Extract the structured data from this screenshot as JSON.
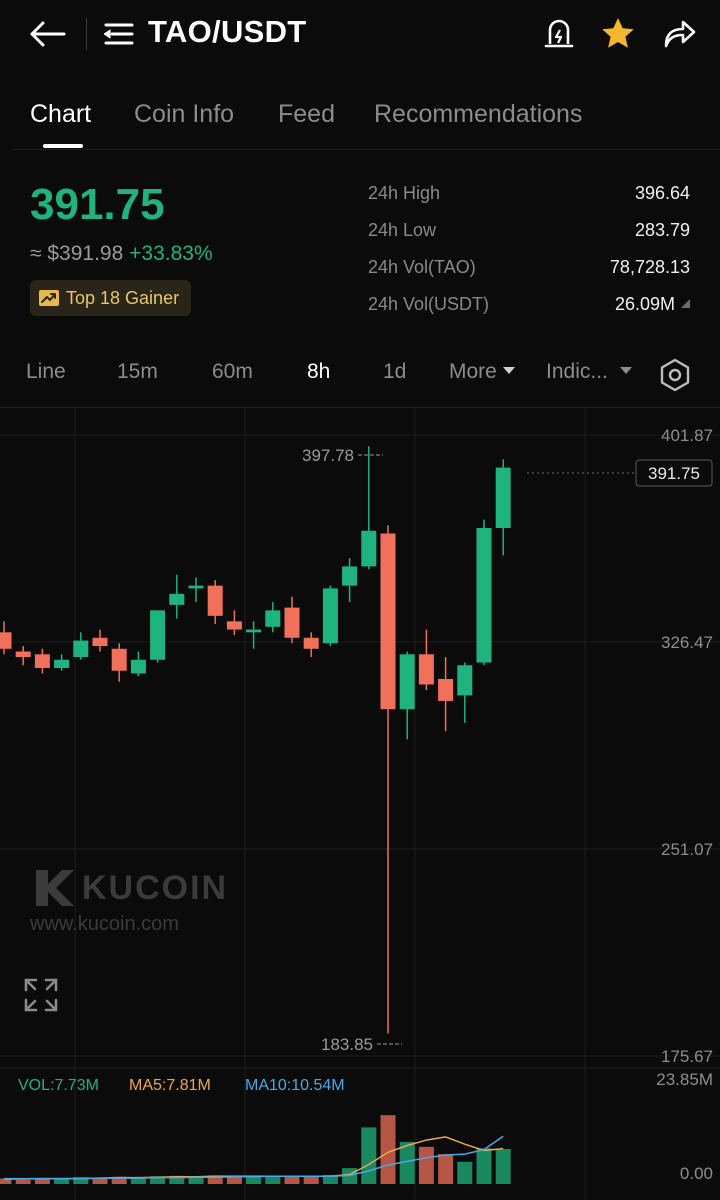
{
  "header": {
    "pair": "TAO/USDT"
  },
  "tabs": [
    {
      "label": "Chart",
      "active": true
    },
    {
      "label": "Coin Info",
      "active": false
    },
    {
      "label": "Feed",
      "active": false
    },
    {
      "label": "Recommendations",
      "active": false
    }
  ],
  "price": {
    "last": "391.75",
    "usd": "≈ $391.98",
    "change": "+33.83%",
    "badge": "Top 18 Gainer",
    "color_up": "#1fb37f",
    "color_down": "#f0705a"
  },
  "stats": [
    {
      "label": "24h High",
      "value": "396.64"
    },
    {
      "label": "24h Low",
      "value": "283.79"
    },
    {
      "label": "24h Vol(TAO)",
      "value": "78,728.13"
    },
    {
      "label": "24h Vol(USDT)",
      "value": "26.09M"
    }
  ],
  "timeframes": {
    "line": "Line",
    "m15": "15m",
    "m60": "60m",
    "h8": "8h",
    "d1": "1d",
    "more": "More",
    "indicators": "Indic..."
  },
  "chart_labels": {
    "y_ticks": [
      "401.87",
      "326.47",
      "251.07",
      "175.67"
    ],
    "current_price": "391.75",
    "high_mark": "397.78",
    "low_mark": "183.85",
    "vol_max": "23.85M",
    "vol_min": "0.00",
    "vol": "VOL:7.73M",
    "ma5": "MA5:7.81M",
    "ma10": "MA10:10.54M",
    "watermark_brand": "KUCOIN",
    "watermark_url": "www.kucoin.com"
  },
  "chart_data": {
    "type": "candlestick",
    "ylim": [
      175.67,
      401.87
    ],
    "candles": [
      {
        "o": 330.0,
        "h": 334.0,
        "l": 322.0,
        "c": 324.0
      },
      {
        "o": 323.0,
        "h": 325.0,
        "l": 318.0,
        "c": 321.0
      },
      {
        "o": 322.0,
        "h": 324.0,
        "l": 315.0,
        "c": 317.0
      },
      {
        "o": 317.0,
        "h": 322.0,
        "l": 316.0,
        "c": 320.0
      },
      {
        "o": 321.0,
        "h": 330.0,
        "l": 320.0,
        "c": 327.0
      },
      {
        "o": 328.0,
        "h": 331.0,
        "l": 323.0,
        "c": 325.0
      },
      {
        "o": 324.0,
        "h": 326.0,
        "l": 312.0,
        "c": 316.0
      },
      {
        "o": 315.0,
        "h": 323.0,
        "l": 314.0,
        "c": 320.0
      },
      {
        "o": 320.0,
        "h": 338.0,
        "l": 319.0,
        "c": 338.0
      },
      {
        "o": 340.0,
        "h": 351.0,
        "l": 335.0,
        "c": 344.0
      },
      {
        "o": 346.0,
        "h": 350.0,
        "l": 341.0,
        "c": 347.0
      },
      {
        "o": 347.0,
        "h": 349.0,
        "l": 333.0,
        "c": 336.0
      },
      {
        "o": 334.0,
        "h": 338.0,
        "l": 329.0,
        "c": 331.0
      },
      {
        "o": 330.0,
        "h": 334.0,
        "l": 324.0,
        "c": 331.0
      },
      {
        "o": 332.0,
        "h": 341.0,
        "l": 330.0,
        "c": 338.0
      },
      {
        "o": 339.0,
        "h": 343.0,
        "l": 326.0,
        "c": 328.0
      },
      {
        "o": 328.0,
        "h": 330.0,
        "l": 321.0,
        "c": 324.0
      },
      {
        "o": 326.0,
        "h": 347.0,
        "l": 325.0,
        "c": 346.0
      },
      {
        "o": 347.0,
        "h": 357.0,
        "l": 341.0,
        "c": 354.0
      },
      {
        "o": 354.0,
        "h": 397.78,
        "l": 353.0,
        "c": 367.0
      },
      {
        "o": 366.0,
        "h": 369.0,
        "l": 183.85,
        "c": 302.0
      },
      {
        "o": 302.0,
        "h": 323.0,
        "l": 291.0,
        "c": 322.0
      },
      {
        "o": 322.0,
        "h": 331.0,
        "l": 309.0,
        "c": 311.0
      },
      {
        "o": 313.0,
        "h": 321.0,
        "l": 294.0,
        "c": 305.0
      },
      {
        "o": 307.0,
        "h": 319.0,
        "l": 297.0,
        "c": 318.0
      },
      {
        "o": 319.0,
        "h": 371.0,
        "l": 318.0,
        "c": 368.0
      },
      {
        "o": 368.0,
        "h": 393.0,
        "l": 358.0,
        "c": 390.0
      }
    ],
    "volume": {
      "ylim": [
        0,
        23.85
      ],
      "values": [
        1.2,
        0.9,
        1.3,
        1.1,
        1.5,
        1.4,
        1.6,
        1.4,
        1.7,
        1.8,
        1.6,
        1.9,
        1.7,
        1.5,
        1.6,
        1.7,
        1.8,
        2.0,
        3.5,
        12.5,
        15.2,
        9.3,
        8.2,
        6.6,
        4.9,
        7.9,
        7.73
      ],
      "ma5": [
        1.1,
        1.1,
        1.2,
        1.2,
        1.2,
        1.3,
        1.4,
        1.4,
        1.5,
        1.6,
        1.6,
        1.7,
        1.7,
        1.7,
        1.7,
        1.7,
        1.7,
        1.7,
        2.1,
        4.3,
        7.0,
        8.5,
        9.7,
        10.4,
        8.8,
        7.4,
        7.81
      ],
      "ma10": [
        1.2,
        1.2,
        1.2,
        1.2,
        1.2,
        1.3,
        1.3,
        1.3,
        1.4,
        1.4,
        1.5,
        1.5,
        1.6,
        1.6,
        1.7,
        1.7,
        1.7,
        1.7,
        1.9,
        2.9,
        4.2,
        5.0,
        5.8,
        6.4,
        6.6,
        7.6,
        10.54
      ]
    }
  }
}
